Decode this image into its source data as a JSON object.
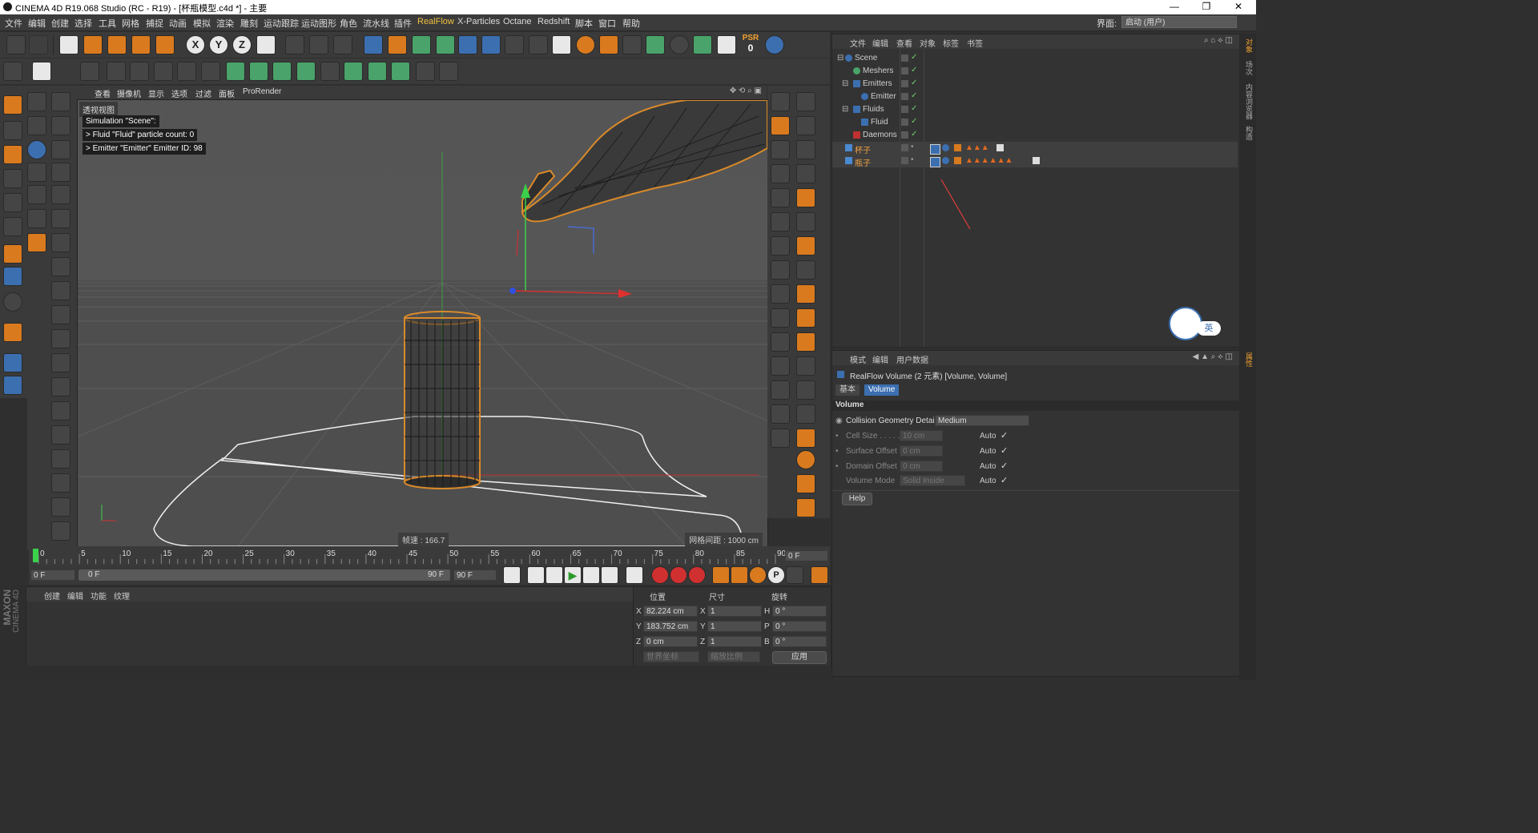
{
  "window": {
    "title": "CINEMA 4D R19.068 Studio (RC - R19) - [杯瓶模型.c4d *] - 主要",
    "controls": [
      "minimize",
      "restore",
      "close"
    ]
  },
  "menu": {
    "items": [
      "文件",
      "编辑",
      "创建",
      "选择",
      "工具",
      "网格",
      "捕捉",
      "动画",
      "模拟",
      "渲染",
      "雕刻",
      "运动跟踪",
      "运动图形",
      "角色",
      "流水线",
      "插件",
      "RealFlow",
      "X-Particles",
      "Octane",
      "Redshift",
      "脚本",
      "窗口",
      "帮助"
    ],
    "interface_label": "界面:",
    "interface_value": "启动 (用户)"
  },
  "viewport": {
    "menu": [
      "查看",
      "摄像机",
      "显示",
      "选项",
      "过滤",
      "面板",
      "ProRender"
    ],
    "view_name": "透视视图",
    "overlay": [
      "Simulation \"Scene\":",
      "> Fluid \"Fluid\" particle count: 0",
      "> Emitter \"Emitter\" Emitter ID: 98"
    ],
    "fps": "帧速 : 166.7",
    "grid_spacing": "网格间距 : 1000 cm"
  },
  "object_manager": {
    "menu": [
      "文件",
      "编辑",
      "查看",
      "对象",
      "标签",
      "书签"
    ],
    "objects": [
      {
        "name": "Scene",
        "indent": 0
      },
      {
        "name": "Meshers",
        "indent": 1
      },
      {
        "name": "Emitters",
        "indent": 1
      },
      {
        "name": "Emitter",
        "indent": 2
      },
      {
        "name": "Fluids",
        "indent": 1
      },
      {
        "name": "Fluid",
        "indent": 2
      },
      {
        "name": "Daemons",
        "indent": 1
      },
      {
        "name": "杯子",
        "indent": 0
      },
      {
        "name": "瓶子",
        "indent": 0
      }
    ]
  },
  "badge": {
    "text": "英"
  },
  "attributes": {
    "menu": [
      "模式",
      "编辑",
      "用户数据"
    ],
    "title": "RealFlow Volume (2 元素) [Volume, Volume]",
    "tabs": [
      "基本",
      "Volume"
    ],
    "section": "Volume",
    "rows": [
      {
        "label": "Collision Geometry Detail",
        "value": "Medium",
        "auto": ""
      },
      {
        "label": "Cell Size . . . . . .",
        "value": "10 cm",
        "auto": "Auto"
      },
      {
        "label": "Surface Offset",
        "value": "0 cm",
        "auto": "Auto"
      },
      {
        "label": "Domain Offset",
        "value": "0 cm",
        "auto": "Auto"
      },
      {
        "label": "Volume Mode",
        "value": "Solid Inside",
        "auto": "Auto"
      }
    ],
    "help": "Help"
  },
  "timeline": {
    "ticks": [
      "0",
      "5",
      "10",
      "15",
      "20",
      "25",
      "30",
      "35",
      "40",
      "45",
      "50",
      "55",
      "60",
      "65",
      "70",
      "75",
      "80",
      "85",
      "90"
    ],
    "current_frame": "0 F",
    "start": "0 F",
    "range_start": "0 F",
    "range_end": "90 F",
    "end": "90 F"
  },
  "material_manager": {
    "menu": [
      "创建",
      "编辑",
      "功能",
      "纹理"
    ]
  },
  "coordinates": {
    "headers": [
      "位置",
      "尺寸",
      "旋转"
    ],
    "rows": [
      {
        "axis": "X",
        "pos": "82.224 cm",
        "saxis": "X",
        "size": "1",
        "raxis": "H",
        "rot": "0 °"
      },
      {
        "axis": "Y",
        "pos": "183.752 cm",
        "saxis": "Y",
        "size": "1",
        "raxis": "P",
        "rot": "0 °"
      },
      {
        "axis": "Z",
        "pos": "0 cm",
        "saxis": "Z",
        "size": "1",
        "raxis": "B",
        "rot": "0 °"
      }
    ],
    "world": "世界坐标",
    "scale": "缩放比例",
    "apply": "应用"
  },
  "maxon": {
    "line1": "MAXON",
    "line2": "CINEMA 4D"
  },
  "psr": {
    "label": "PSR",
    "value": "0"
  },
  "side_tabs": [
    "对象",
    "场次",
    "内容浏览器",
    "构造",
    "属性"
  ],
  "colors": {
    "accent": "#d97a1e",
    "blue": "#3c6fb0",
    "green": "#4aa36a",
    "annotation": "#e03c3c"
  }
}
